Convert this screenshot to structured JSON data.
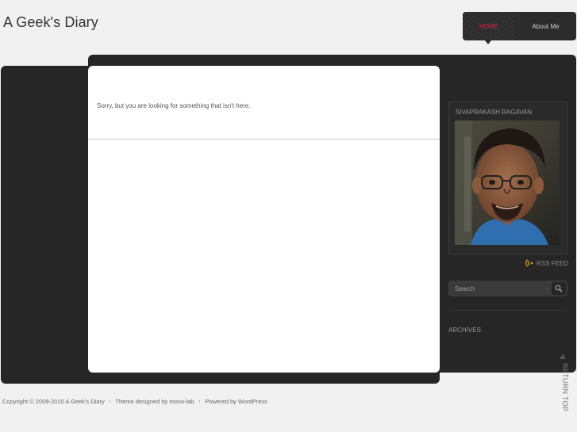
{
  "site": {
    "title": "A Geek's Diary"
  },
  "nav": {
    "items": [
      {
        "label": "HOME",
        "active": true
      },
      {
        "label": "About Me",
        "active": false
      }
    ]
  },
  "content": {
    "message": "Sorry, but you are looking for something that isn't here."
  },
  "sidebar": {
    "profile_name": "SIVAPRAKASH RAGAVAN",
    "rss_label": "RSS FEED",
    "search": {
      "placeholder": "Search"
    },
    "archives_title": "ARCHIVES"
  },
  "return_top": {
    "label": "RETURN TOP"
  },
  "footer": {
    "copyright": "Copyright ©  2009-2010  A Geek's Diary",
    "theme": "Theme designed by mono-lab",
    "powered": "Powered by WordPress"
  },
  "colors": {
    "accent": "#e0234a",
    "dark_panel": "#262626",
    "background": "#f1f1f1",
    "rss": "#e8a317"
  },
  "icons": {
    "rss": "rss-icon",
    "search": "search-icon",
    "return": "arrow-up-icon"
  }
}
